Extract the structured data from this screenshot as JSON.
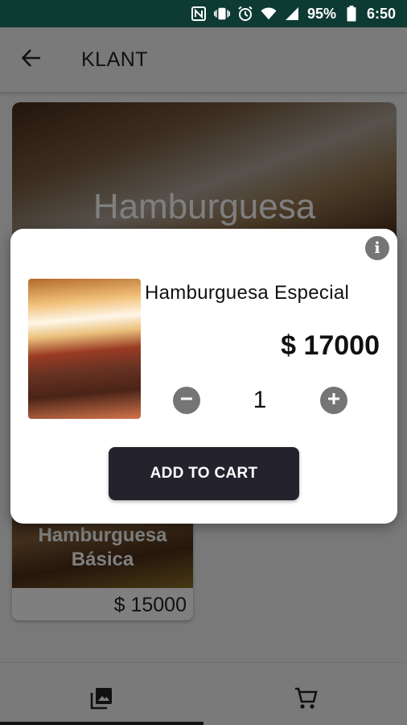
{
  "status_bar": {
    "battery_percent": "95%",
    "time": "6:50",
    "icons": [
      "nfc-icon",
      "vibrate-icon",
      "alarm-icon",
      "wifi-icon",
      "signal-icon",
      "battery-icon"
    ]
  },
  "app_bar": {
    "title": "KLANT",
    "back_icon": "arrow-back-icon"
  },
  "hero": {
    "title": "Hamburguesa"
  },
  "product_cards": [
    {
      "name": "Hamburguesa Básica",
      "price": "$ 15000"
    }
  ],
  "dialog": {
    "product_name": "Hamburguesa Especial",
    "price": "$ 17000",
    "quantity": "1",
    "add_to_cart_label": "ADD TO CART",
    "info_icon": "info-icon",
    "minus_icon": "minus-circle-icon",
    "plus_icon": "plus-circle-icon"
  },
  "bottom_nav": {
    "items": [
      {
        "icon": "gallery-icon",
        "active": true
      },
      {
        "icon": "cart-icon",
        "active": false
      }
    ]
  },
  "colors": {
    "status_bar": "#0d3a32",
    "button_dark": "#24222d",
    "icon_grey": "#757575"
  }
}
